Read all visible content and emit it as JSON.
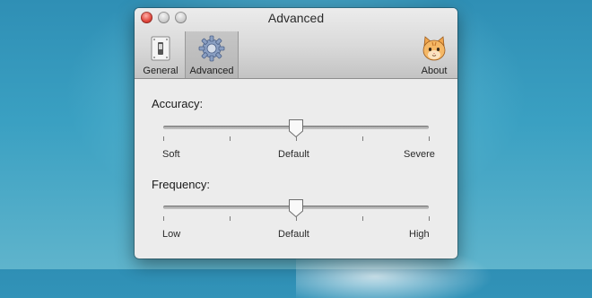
{
  "window": {
    "title": "Advanced"
  },
  "toolbar": {
    "items": [
      {
        "label": "General",
        "icon": "switch-icon"
      },
      {
        "label": "Advanced",
        "icon": "gear-icon",
        "selected": true
      },
      {
        "label": "About",
        "icon": "cat-icon"
      }
    ]
  },
  "accuracy": {
    "label": "Accuracy:",
    "value_fraction": 0.5,
    "tick_count": 5,
    "labels": {
      "min": "Soft",
      "mid": "Default",
      "max": "Severe"
    }
  },
  "frequency": {
    "label": "Frequency:",
    "value_fraction": 0.5,
    "tick_count": 5,
    "labels": {
      "min": "Low",
      "mid": "Default",
      "max": "High"
    }
  },
  "colors": {
    "close_button": "#e0463c",
    "desktop": "#3aa0c2"
  }
}
